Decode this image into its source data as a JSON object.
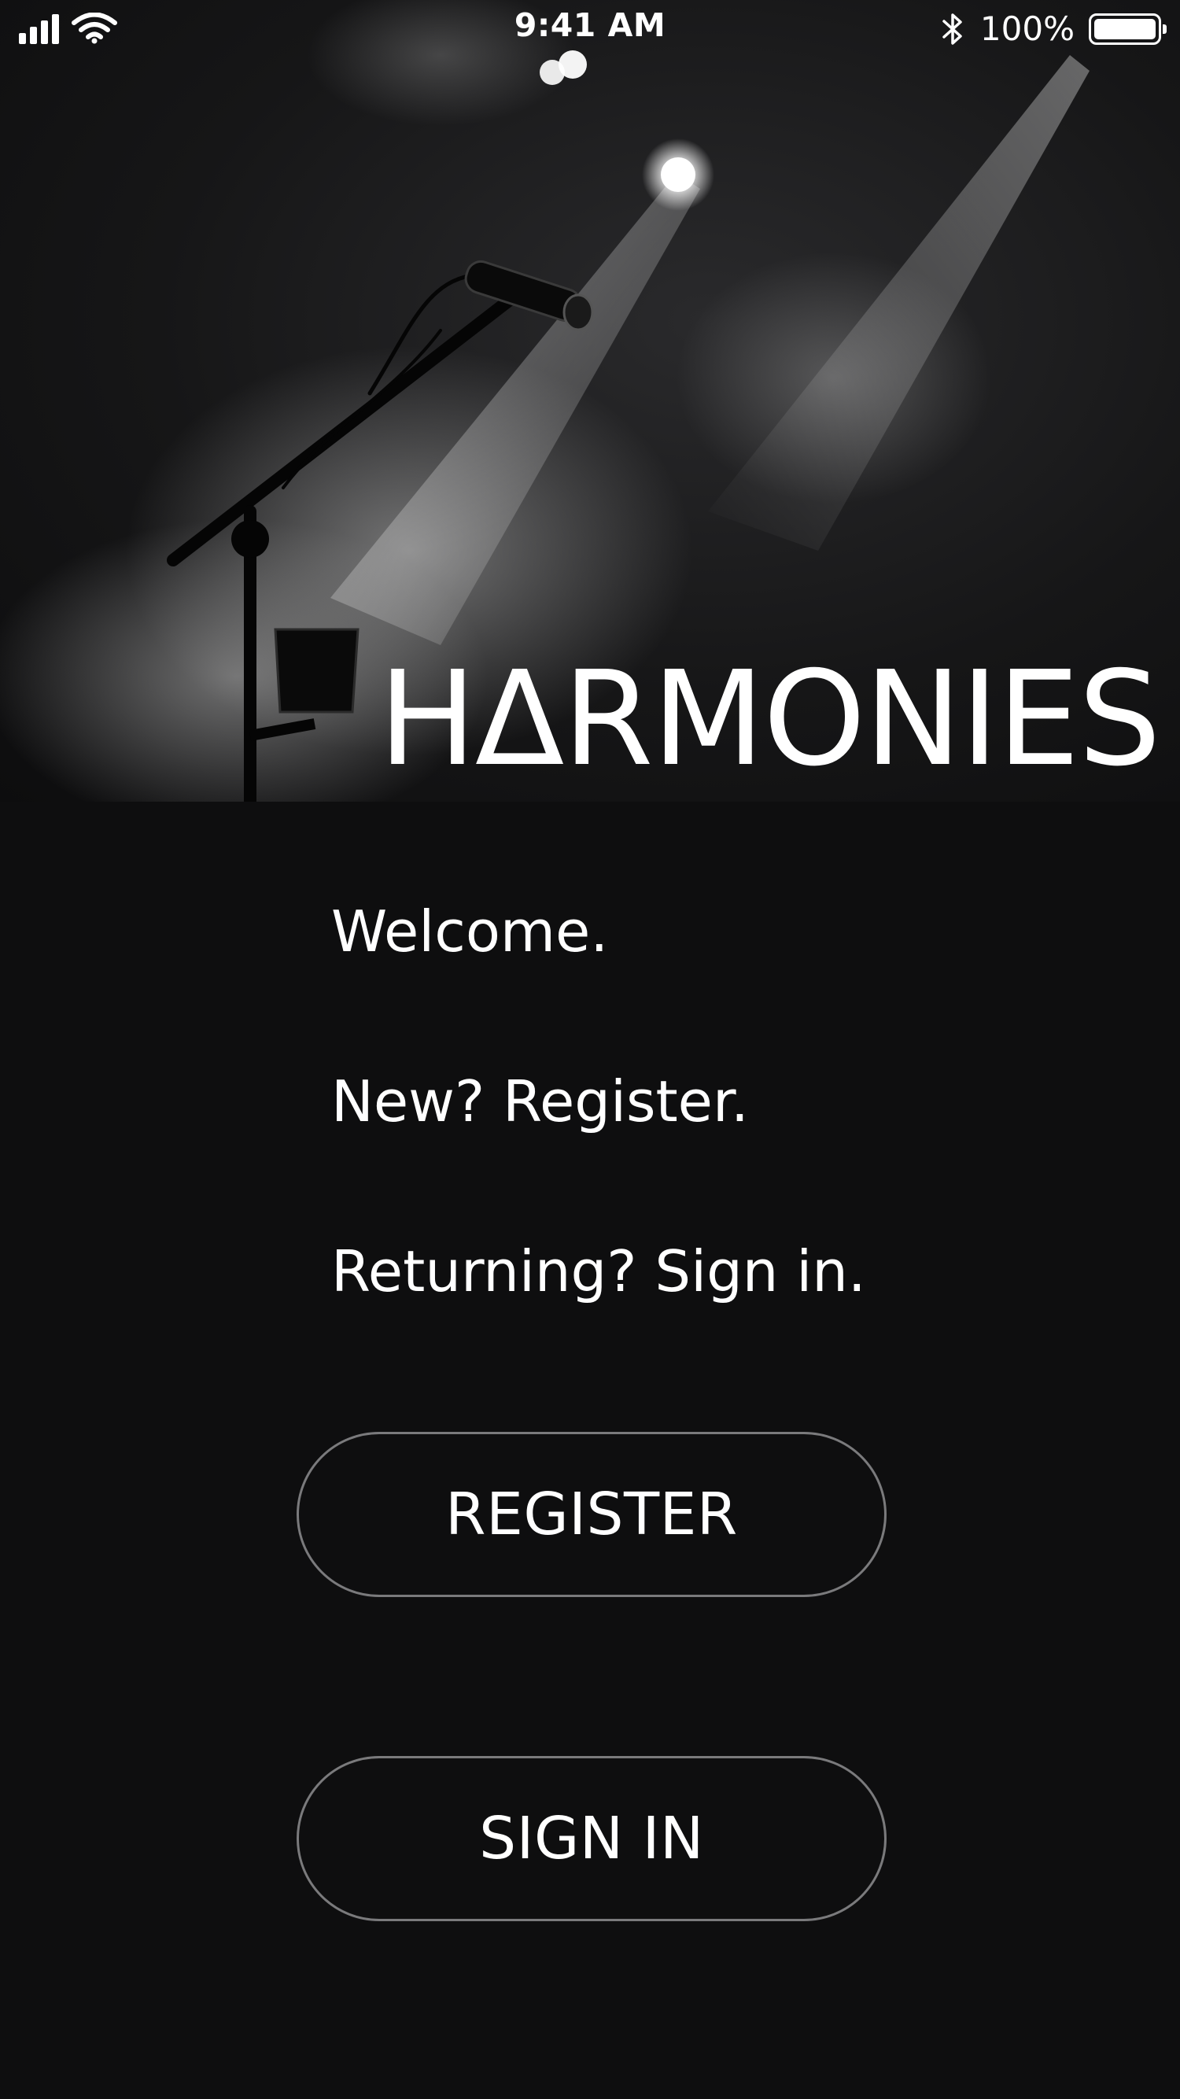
{
  "status_bar": {
    "time": "9:41 AM",
    "battery_percent": "100%",
    "battery_level": 1.0,
    "icons": [
      "signal-bars-icon",
      "wifi-icon",
      "bluetooth-icon",
      "battery-icon"
    ]
  },
  "hero": {
    "brand_title": "HΔRMONIES",
    "image": "microphone-stage-spotlight-photo"
  },
  "intro": {
    "welcome": "Welcome.",
    "register_prompt": "New? Register.",
    "signin_prompt": "Returning? Sign in."
  },
  "buttons": {
    "register_label": "REGISTER",
    "signin_label": "SIGN IN"
  },
  "colors": {
    "background": "#0e0e0f",
    "text": "#ffffff",
    "button_border": "#7a7a7c"
  }
}
